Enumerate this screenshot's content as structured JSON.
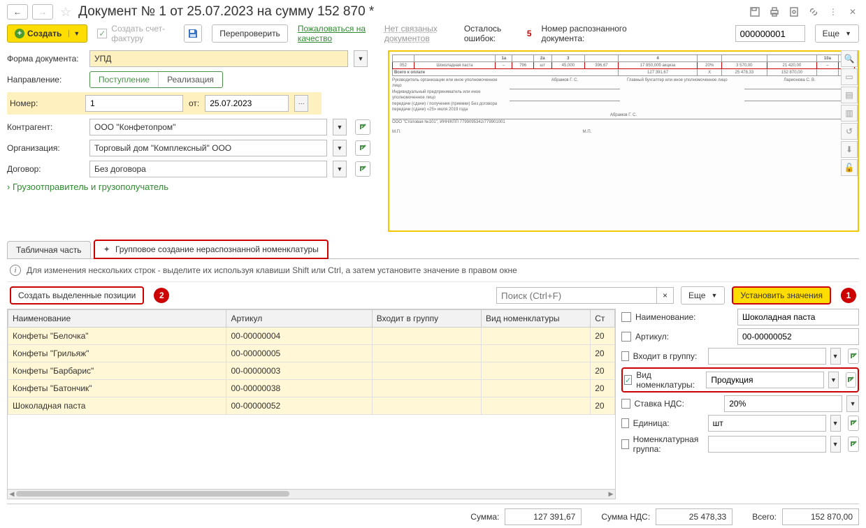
{
  "titlebar": {
    "title": "Документ № 1 от 25.07.2023 на сумму 152 870 *"
  },
  "cmdbar": {
    "create": "Создать",
    "create_invoice": "Создать счет-фактуру",
    "recheck": "Перепроверить",
    "complain": "Пожаловаться на качество",
    "no_linked": "Нет связаных документов",
    "remaining_lbl": "Осталось ошибок:",
    "remaining_val": "5",
    "docnum_lbl": "Номер распознанного документа:",
    "docnum_val": "000000001",
    "more": "Еще"
  },
  "form": {
    "doc_form_lbl": "Форма документа:",
    "doc_form_val": "УПД",
    "direction_lbl": "Направление:",
    "direction_opt1": "Поступление",
    "direction_opt2": "Реализация",
    "number_lbl": "Номер:",
    "number_val": "1",
    "from_lbl": "от:",
    "date_val": "25.07.2023",
    "counterparty_lbl": "Контрагент:",
    "counterparty_val": "ООО \"Конфетопром\"",
    "org_lbl": "Организация:",
    "org_val": "Торговый дом \"Комплексный\" ООО",
    "contract_lbl": "Договор:",
    "contract_val": "Без договора",
    "shipper_link": "Грузоотправитель и грузополучатель"
  },
  "preview": {
    "row": {
      "code": "052",
      "name": "Шоколадная паста",
      "qty": "796",
      "unit": "шт",
      "amount": "45,000",
      "sum": "396,67",
      "total1": "17 850,00б акциза",
      "vat": "20%",
      "vat_sum": "3 570,00",
      "total2": "21 420,00"
    },
    "total_lbl": "Всего к оплате",
    "totals": {
      "a": "127 391,67",
      "x": "X",
      "b": "25 478,33",
      "c": "152 870,00"
    },
    "t1": "Руководитель организации или иное уполномоченное лицо",
    "t1v": "Абрамов Г. С.",
    "t2": "Главный бухгалтер или иное уполномоченное лицо",
    "t2v": "Ларионова С. В.",
    "t3": "Индивидуальный предприниматель или иное уполномоченное лицо",
    "t4": "передачи (сдачи) / получения (приемки)    Без договора",
    "t5": "передачи (сдачи)   «25»  июля  2019 года",
    "t6": "Абрамов Г. С.",
    "t7": "ООО \"Столовая №101\", ИНН/КПП 7799095342/779901001"
  },
  "tabs": {
    "tab1": "Табличная часть",
    "tab2": "Групповое создание нераспознанной номенклатуры"
  },
  "info": "Для изменения нескольких строк - выделите их используя клавиши Shift или Ctrl, а затем установите значение в правом окне",
  "actionbar": {
    "create_selected": "Создать выделенные позиции",
    "badge2": "2",
    "search_ph": "Поиск (Ctrl+F)",
    "more": "Еще",
    "set_values": "Установить значения",
    "badge1": "1"
  },
  "grid": {
    "cols": {
      "name": "Наименование",
      "article": "Артикул",
      "group": "Входит в группу",
      "type": "Вид номенклатуры",
      "rate": "Ст"
    },
    "rows": [
      {
        "name": "Конфеты \"Белочка\"",
        "article": "00-00000004",
        "group": "",
        "type": "",
        "rate": "20"
      },
      {
        "name": "Конфеты \"Грильяж\"",
        "article": "00-00000005",
        "group": "",
        "type": "",
        "rate": "20"
      },
      {
        "name": "Конфеты \"Барбарис\"",
        "article": "00-00000003",
        "group": "",
        "type": "",
        "rate": "20"
      },
      {
        "name": "Конфеты \"Батончик\"",
        "article": "00-00000038",
        "group": "",
        "type": "",
        "rate": "20"
      },
      {
        "name": "Шоколадная паста",
        "article": "00-00000052",
        "group": "",
        "type": "",
        "rate": "20"
      }
    ]
  },
  "side": {
    "name_lbl": "Наименование:",
    "name_val": "Шоколадная паста",
    "article_lbl": "Артикул:",
    "article_val": "00-00000052",
    "group_lbl": "Входит в группу:",
    "group_val": "",
    "type_lbl": "Вид номенклатуры:",
    "type_val": "Продукция",
    "type_checked": true,
    "vat_lbl": "Ставка НДС:",
    "vat_val": "20%",
    "unit_lbl": "Единица:",
    "unit_val": "шт",
    "nomgroup_lbl": "Номенклатурная группа:",
    "nomgroup_val": ""
  },
  "footer": {
    "sum_lbl": "Сумма:",
    "sum_val": "127 391,67",
    "vat_lbl": "Сумма НДС:",
    "vat_val": "25 478,33",
    "total_lbl": "Всего:",
    "total_val": "152 870,00"
  }
}
